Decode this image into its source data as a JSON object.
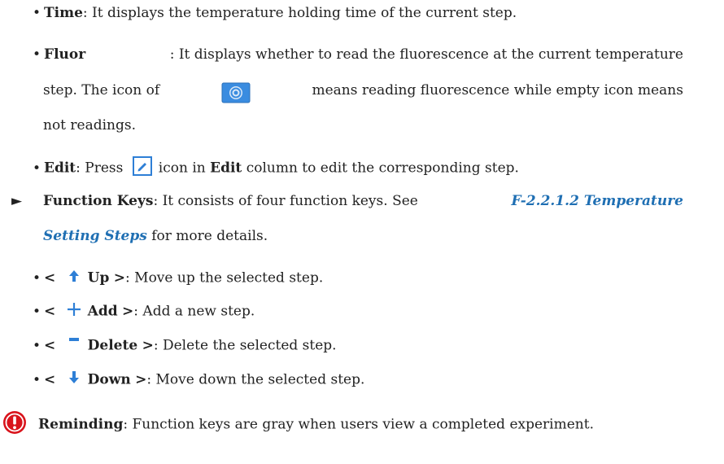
{
  "time": {
    "term": "Time",
    "desc": ": It displays the temperature holding time of the current step."
  },
  "fluor": {
    "term": "Fluor",
    "line1": ": It displays whether to read the fluorescence at the current temperature",
    "line2a": "step. The icon of",
    "line2b": "means reading fluorescence while empty icon means",
    "line3": "not readings."
  },
  "edit": {
    "term": "Edit",
    "pre": ": Press",
    "mid": "icon in",
    "term2": "Edit",
    "post": "column to edit the corresponding step."
  },
  "function_keys": {
    "marker": "►",
    "term": "Function Keys",
    "line1": ": It consists of four function keys. See",
    "ref1": "F-2.2.1.2 Temperature",
    "ref2": "Setting Steps",
    "line2": " for more details."
  },
  "keys": [
    {
      "icon": "up-arrow-icon",
      "label": "Up",
      "desc": ": Move up the selected step."
    },
    {
      "icon": "plus-icon",
      "label": "Add",
      "desc": ": Add a new step."
    },
    {
      "icon": "minus-icon",
      "label": "Delete",
      "desc": ": Delete the selected step."
    },
    {
      "icon": "down-arrow-icon",
      "label": "Down",
      "desc": ": Move down the selected step."
    }
  ],
  "reminding": {
    "term": "Reminding",
    "desc": ": Function keys are gray when users view a completed experiment."
  },
  "colors": {
    "link": "#1f6fb3",
    "icon_blue": "#2e7fd6",
    "warning_red": "#d9141c"
  }
}
